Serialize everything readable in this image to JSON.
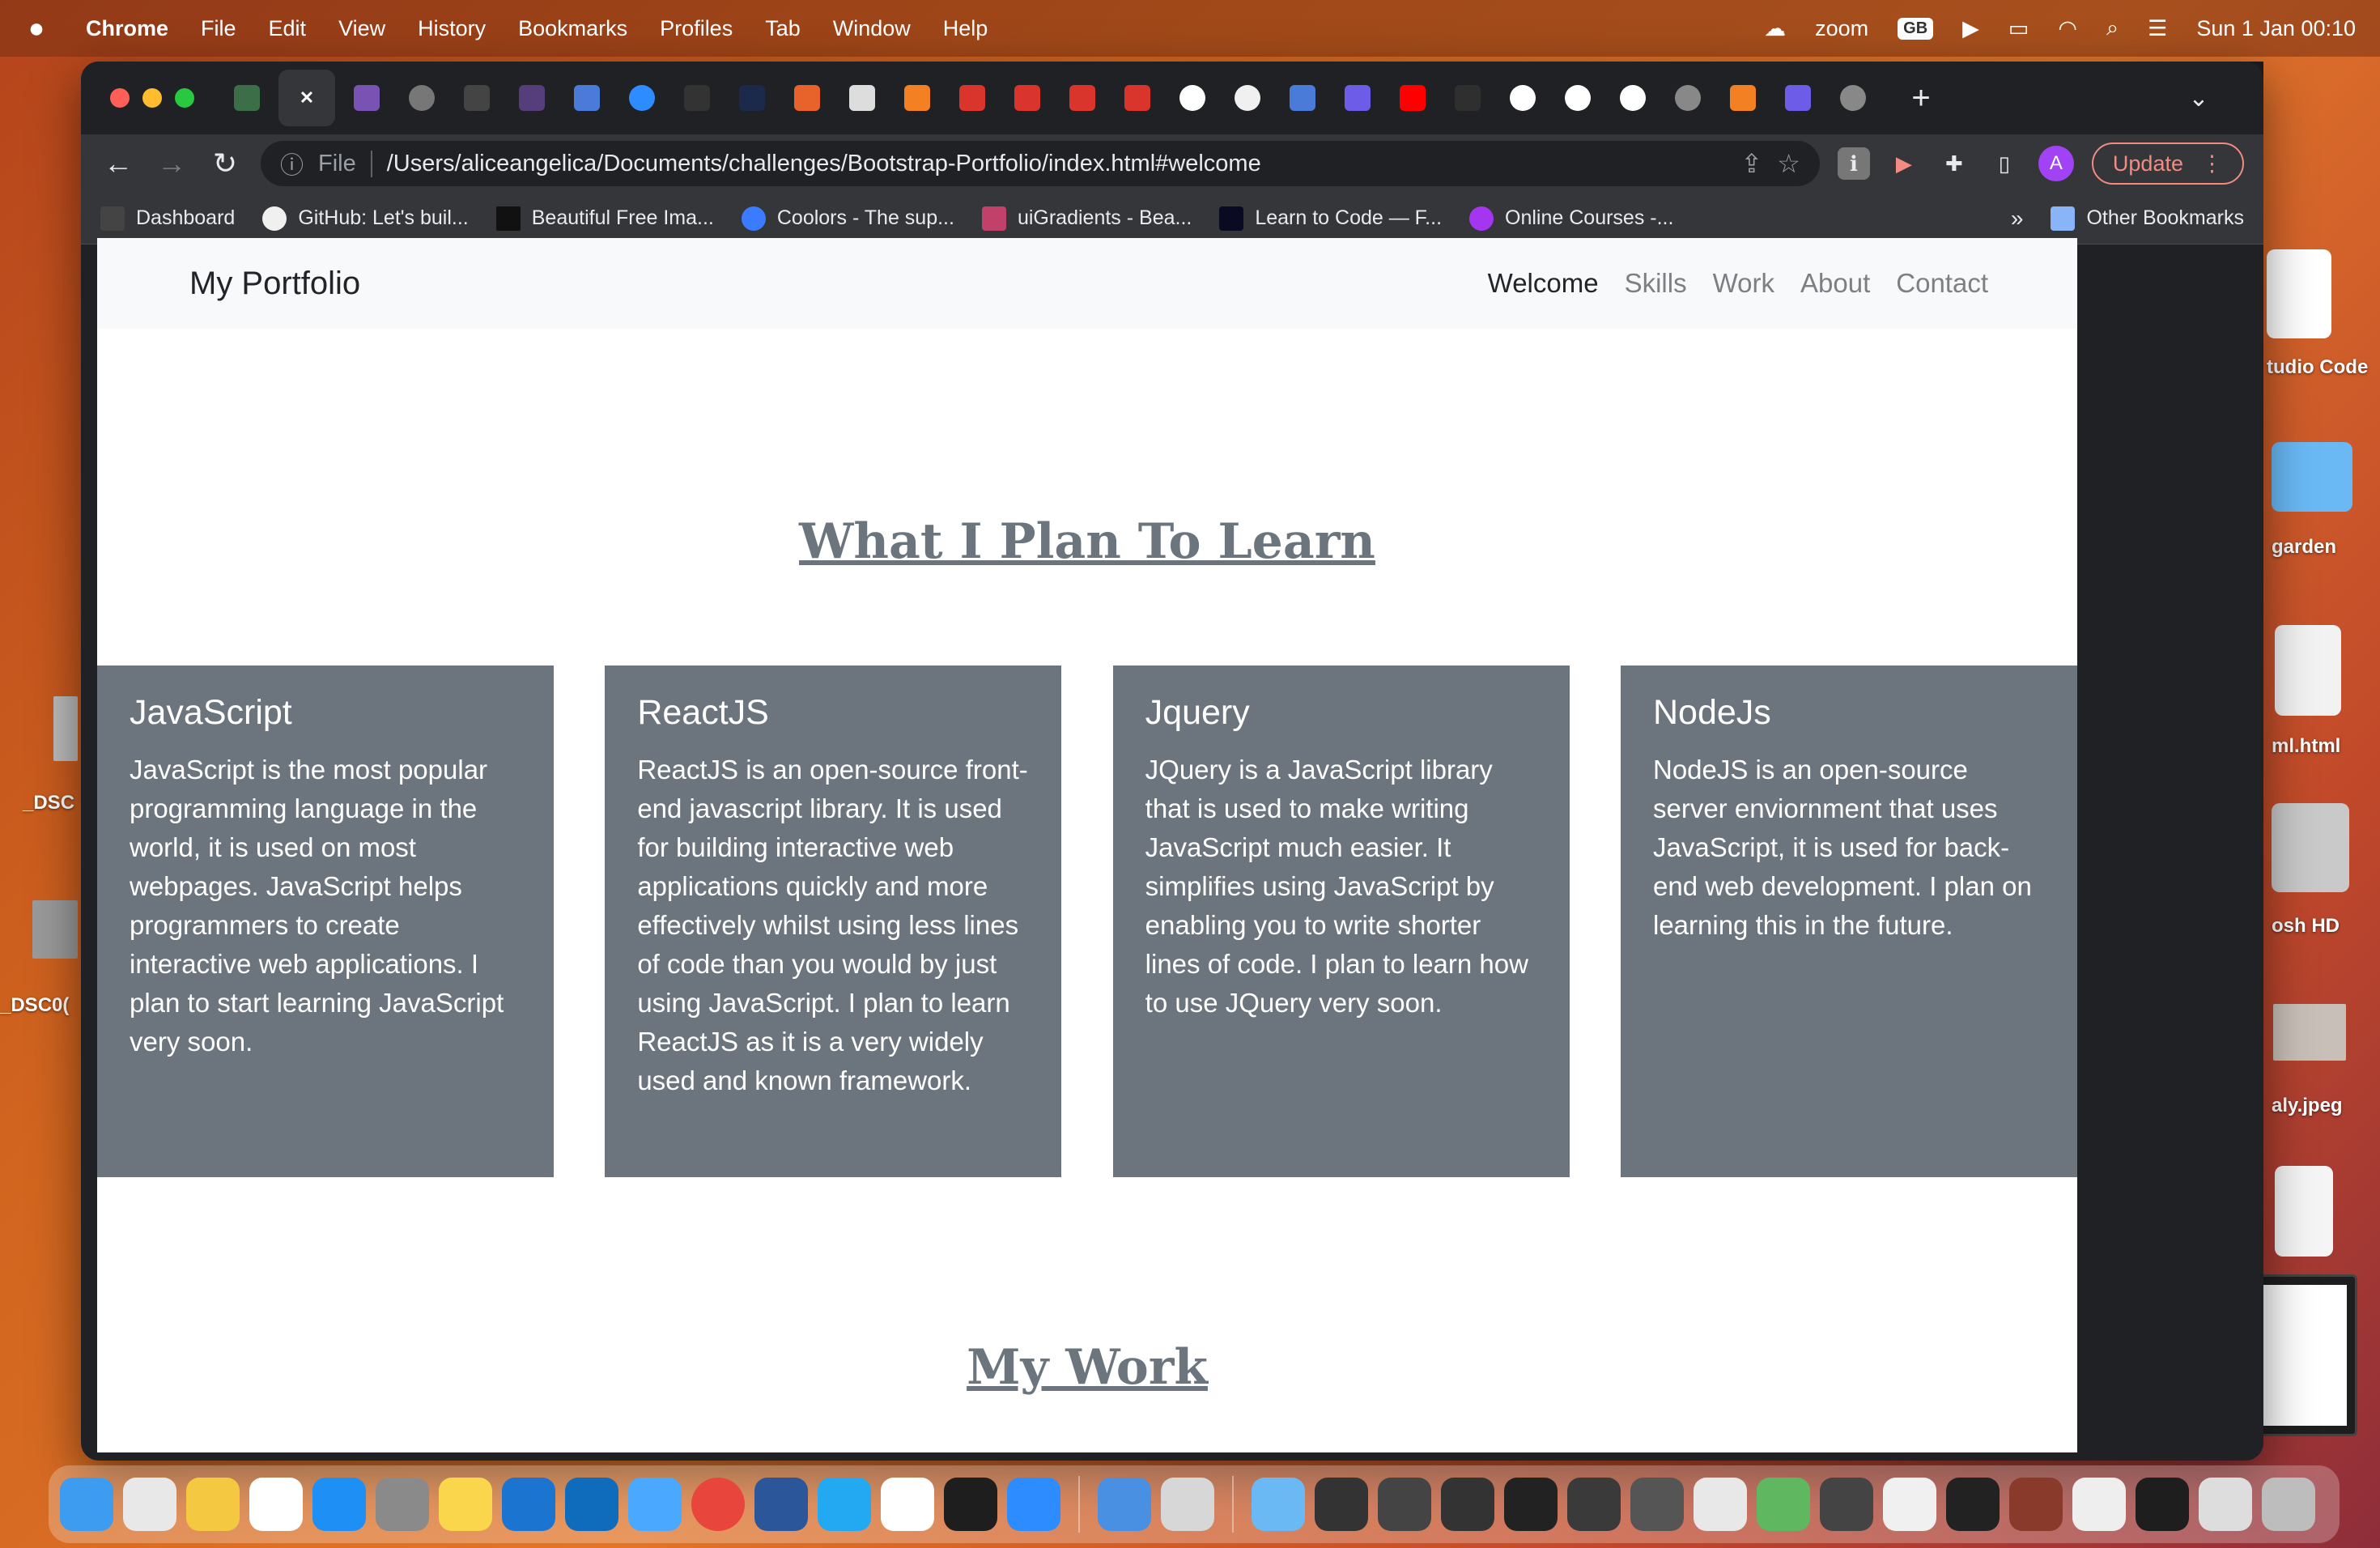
{
  "menubar": {
    "app": "Chrome",
    "items": [
      "File",
      "Edit",
      "View",
      "History",
      "Bookmarks",
      "Profiles",
      "Tab",
      "Window",
      "Help"
    ],
    "zoom": "zoom",
    "keyboard": "GB",
    "datetime": "Sun 1 Jan  00:10"
  },
  "toolbar": {
    "file_label": "File",
    "url": "/Users/aliceangelica/Documents/challenges/Bootstrap-Portfolio/index.html#welcome",
    "update_label": "Update"
  },
  "bookmarks": [
    "Dashboard",
    "GitHub: Let's buil...",
    "Beautiful Free Ima...",
    "Coolors - The sup...",
    "uiGradients - Bea...",
    "Learn to Code — F...",
    "Online Courses -..."
  ],
  "bookmarks_more": "»",
  "other_bookmarks": "Other Bookmarks",
  "site": {
    "brand": "My Portfolio",
    "nav": [
      "Welcome",
      "Skills",
      "Work",
      "About",
      "Contact"
    ],
    "plan_title": "What I Plan To Learn",
    "cards": [
      {
        "title": "JavaScript",
        "text": "JavaScript is the most popular programming language in the world, it is used on most webpages. JavaScript helps programmers to create interactive web applications. I plan to start learning JavaScript very soon."
      },
      {
        "title": "ReactJS",
        "text": "ReactJS is an open-source front-end javascript library. It is used for building interactive web applications quickly and more effectively whilst using less lines of code than you would by just using JavaScript. I plan to learn ReactJS as it is a very widely used and known framework."
      },
      {
        "title": "Jquery",
        "text": "JQuery is a JavaScript library that is used to make writing JavaScript much easier. It simplifies using JavaScript by enabling you to write shorter lines of code. I plan to learn how to use JQuery very soon."
      },
      {
        "title": "NodeJs",
        "text": "NodeJS is an open-source server enviornment that uses JavaScript, it is used for back-end web development. I plan on learning this in the future."
      }
    ],
    "work_title": "My Work"
  },
  "desktop": {
    "labels": [
      "tudio Code",
      "garden",
      "ml.html",
      "osh HD",
      "aly.jpeg",
      "_DSC",
      "_DSC0("
    ]
  }
}
